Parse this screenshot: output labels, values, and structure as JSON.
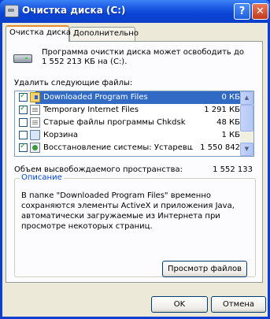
{
  "window": {
    "title": "Очистка диска  (C:)",
    "help_symbol": "?",
    "close_symbol": "✕"
  },
  "tabs": [
    {
      "label": "Очистка диска",
      "active": true
    },
    {
      "label": "Дополнительно",
      "active": false
    }
  ],
  "intro_text": "Программа очистки диска может освободить до 1 552 213 КБ на  (C:).",
  "files_label": "Удалить следующие файлы:",
  "files": [
    {
      "name": "Downloaded Program Files",
      "size": "0 КБ",
      "checked": true,
      "selected": true,
      "icon": "folder-icon"
    },
    {
      "name": "Temporary Internet Files",
      "size": "1 291 КБ",
      "checked": true,
      "selected": false,
      "icon": "document-icon"
    },
    {
      "name": "Старые файлы программы Chkdsk",
      "size": "48 КБ",
      "checked": false,
      "selected": false,
      "icon": "document-icon"
    },
    {
      "name": "Корзина",
      "size": "1 КБ",
      "checked": false,
      "selected": false,
      "icon": "recycle-bin-icon"
    },
    {
      "name": "Восстановление системы: Устаревши...",
      "size": "1 550 842",
      "checked": true,
      "selected": false,
      "icon": "system-restore-icon"
    }
  ],
  "total": {
    "label": "Объем высвобождаемого пространства:",
    "value": "1 552 133"
  },
  "description": {
    "legend": "Описание",
    "text": "В папке \"Downloaded Program Files\" временно сохраняются элементы ActiveX и приложения Java, автоматически загружаемые из Интернета при просмотре некоторых страниц."
  },
  "buttons": {
    "view_files": "Просмотр файлов",
    "ok": "OK",
    "cancel": "Отмена"
  },
  "scroll": {
    "up": "▲",
    "down": "▼"
  }
}
